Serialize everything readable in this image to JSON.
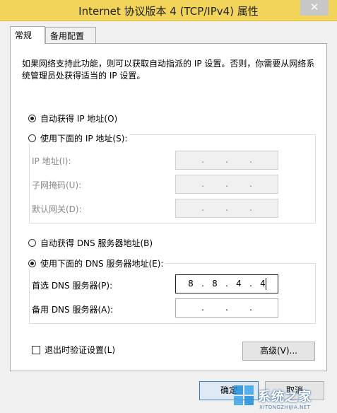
{
  "window": {
    "title": "Internet 协议版本 4 (TCP/IPv4) 属性",
    "close_glyph": "✕"
  },
  "tabs": [
    {
      "label": "常规",
      "active": true
    },
    {
      "label": "备用配置",
      "active": false
    }
  ],
  "description": "如果网络支持此功能，则可以获取自动指派的 IP 设置。否则，你需要从网络系统管理员处获得适当的 IP 设置。",
  "ip_section": {
    "auto_label": "自动获得 IP 地址(O)",
    "auto_selected": true,
    "manual_label": "使用下面的 IP 地址(S):",
    "manual_selected": false,
    "fields": [
      {
        "label": "IP 地址(I):",
        "octets": [
          "",
          "",
          "",
          ""
        ]
      },
      {
        "label": "子网掩码(U):",
        "octets": [
          "",
          "",
          "",
          ""
        ]
      },
      {
        "label": "默认网关(D):",
        "octets": [
          "",
          "",
          "",
          ""
        ]
      }
    ]
  },
  "dns_section": {
    "auto_label": "自动获得 DNS 服务器地址(B)",
    "auto_selected": false,
    "manual_label": "使用下面的 DNS 服务器地址(E):",
    "manual_selected": true,
    "fields": [
      {
        "label": "首选 DNS 服务器(P):",
        "octets": [
          "8",
          "8",
          "4",
          "4"
        ]
      },
      {
        "label": "备用 DNS 服务器(A):",
        "octets": [
          "",
          "",
          "",
          ""
        ]
      }
    ]
  },
  "validate_label": "退出时验证设置(L)",
  "validate_checked": false,
  "advanced_label": "高级(V)...",
  "ok_label": "确定",
  "cancel_label": "取消",
  "watermark": {
    "text": "系统之家",
    "sub": "XITONGZHIJIA.NET"
  },
  "colors": {
    "titlebar": "#f2d45a",
    "window_bg": "#f0f0f0",
    "panel_bg": "#ffffff"
  }
}
